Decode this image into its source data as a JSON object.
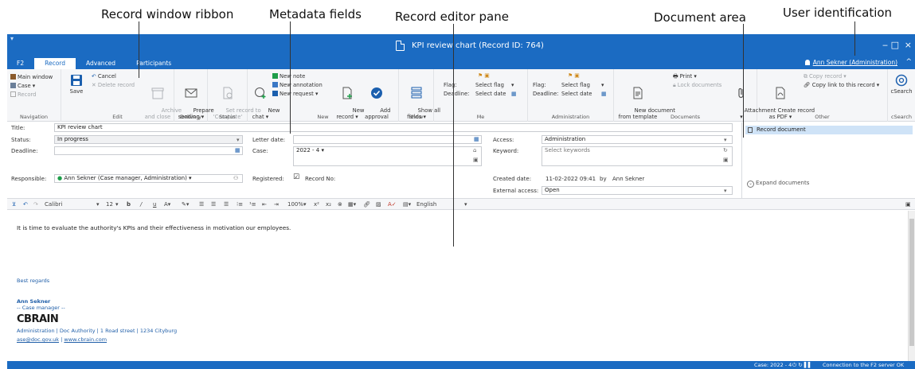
{
  "callouts": {
    "ribbon": "Record window ribbon",
    "metadata": "Metadata fields",
    "editor": "Record editor pane",
    "document": "Document area",
    "user": "User identification"
  },
  "window": {
    "title": "KPI review chart (Record ID: 764)",
    "tabs": [
      "F2",
      "Record",
      "Advanced",
      "Participants"
    ],
    "active_tab": "Record",
    "user": "Ann Sekner (Administration)",
    "controls": {
      "minimize": "‒",
      "maximize": "□",
      "close": "×",
      "collapse": "^"
    }
  },
  "ribbon": {
    "navigation": {
      "label": "Navigation",
      "main_window": "Main window",
      "case": "Case ▾",
      "record": "Record"
    },
    "edit": {
      "label": "Edit",
      "save": "Save",
      "cancel": "Cancel",
      "delete": "Delete record",
      "archive": "Archive\nand close"
    },
    "delivery": {
      "label": "Delivery",
      "prepare": "Prepare\nsending ▾"
    },
    "status": {
      "label": "Status",
      "set": "Set record to\n'Complete'"
    },
    "new": {
      "label": "New",
      "new_chat": "New\nchat ▾",
      "new_note": "New note",
      "new_annotation": "New annotation",
      "new_request": "New request ▾",
      "new_record": "New\nrecord ▾",
      "add_approval": "Add\napproval"
    },
    "show": {
      "label": "Show",
      "show_all": "Show all\nfields ▾"
    },
    "me": {
      "label": "Me",
      "flag": "Flag:",
      "flag_val": "Select flag",
      "deadline": "Deadline:",
      "deadline_val": "Select date"
    },
    "administration": {
      "label": "Administration",
      "flag": "Flag:",
      "flag_val": "Select flag",
      "deadline": "Deadline:",
      "deadline_val": "Select date"
    },
    "documents": {
      "label": "Documents",
      "new_from_template": "New document\nfrom template",
      "print": "Print ▾",
      "lock": "Lock documents",
      "attachment": "Attachment\n▾"
    },
    "other": {
      "label": "Other",
      "create_pdf": "Create record\nas PDF ▾",
      "copy_record": "Copy record ▾",
      "copy_link": "Copy link to this record ▾"
    },
    "csearch": {
      "label": "cSearch",
      "btn": "cSearch"
    }
  },
  "meta": {
    "title_label": "Title:",
    "title_value": "KPI review chart",
    "status_label": "Status:",
    "status_value": "In progress",
    "deadline_label": "Deadline:",
    "responsible_label": "Responsible:",
    "responsible_value": "Ann Sekner (Case manager, Administration) ▾",
    "letter_date_label": "Letter date:",
    "case_label": "Case:",
    "case_value": "2022 - 4 ▾",
    "registered_label": "Registered:",
    "record_no": "Record No:",
    "access_label": "Access:",
    "access_value": "Administration",
    "keyword_label": "Keyword:",
    "keyword_placeholder": "Select keywords",
    "created_label": "Created date:",
    "created_value": "11-02-2022 09:41",
    "created_by": "by",
    "created_user": "Ann Sekner",
    "external_label": "External access:",
    "external_value": "Open"
  },
  "docarea": {
    "record_document": "Record document",
    "expand": "Expand documents"
  },
  "toolbar": {
    "font": "Calibri",
    "size": "12",
    "zoom": "100%",
    "language": "English"
  },
  "editor": {
    "body": "It is time to evaluate the authority's KPIs and their effectiveness in motivation our employees.",
    "greeting": "Best regards",
    "sig_name": "Ann Sekner",
    "sig_role": "-- Case manager --",
    "logo": "CBRAIN",
    "sig_address": "Administration  |  Doc Authority  |  1 Road street  |  1234 Cityburg",
    "sig_email": "ase@doc.gov.uk",
    "sig_sep": "|",
    "sig_web": "www.cbrain.com"
  },
  "statusbar": {
    "case": "Case: 2022 - 4",
    "server": "Connection to the F2 server OK"
  }
}
